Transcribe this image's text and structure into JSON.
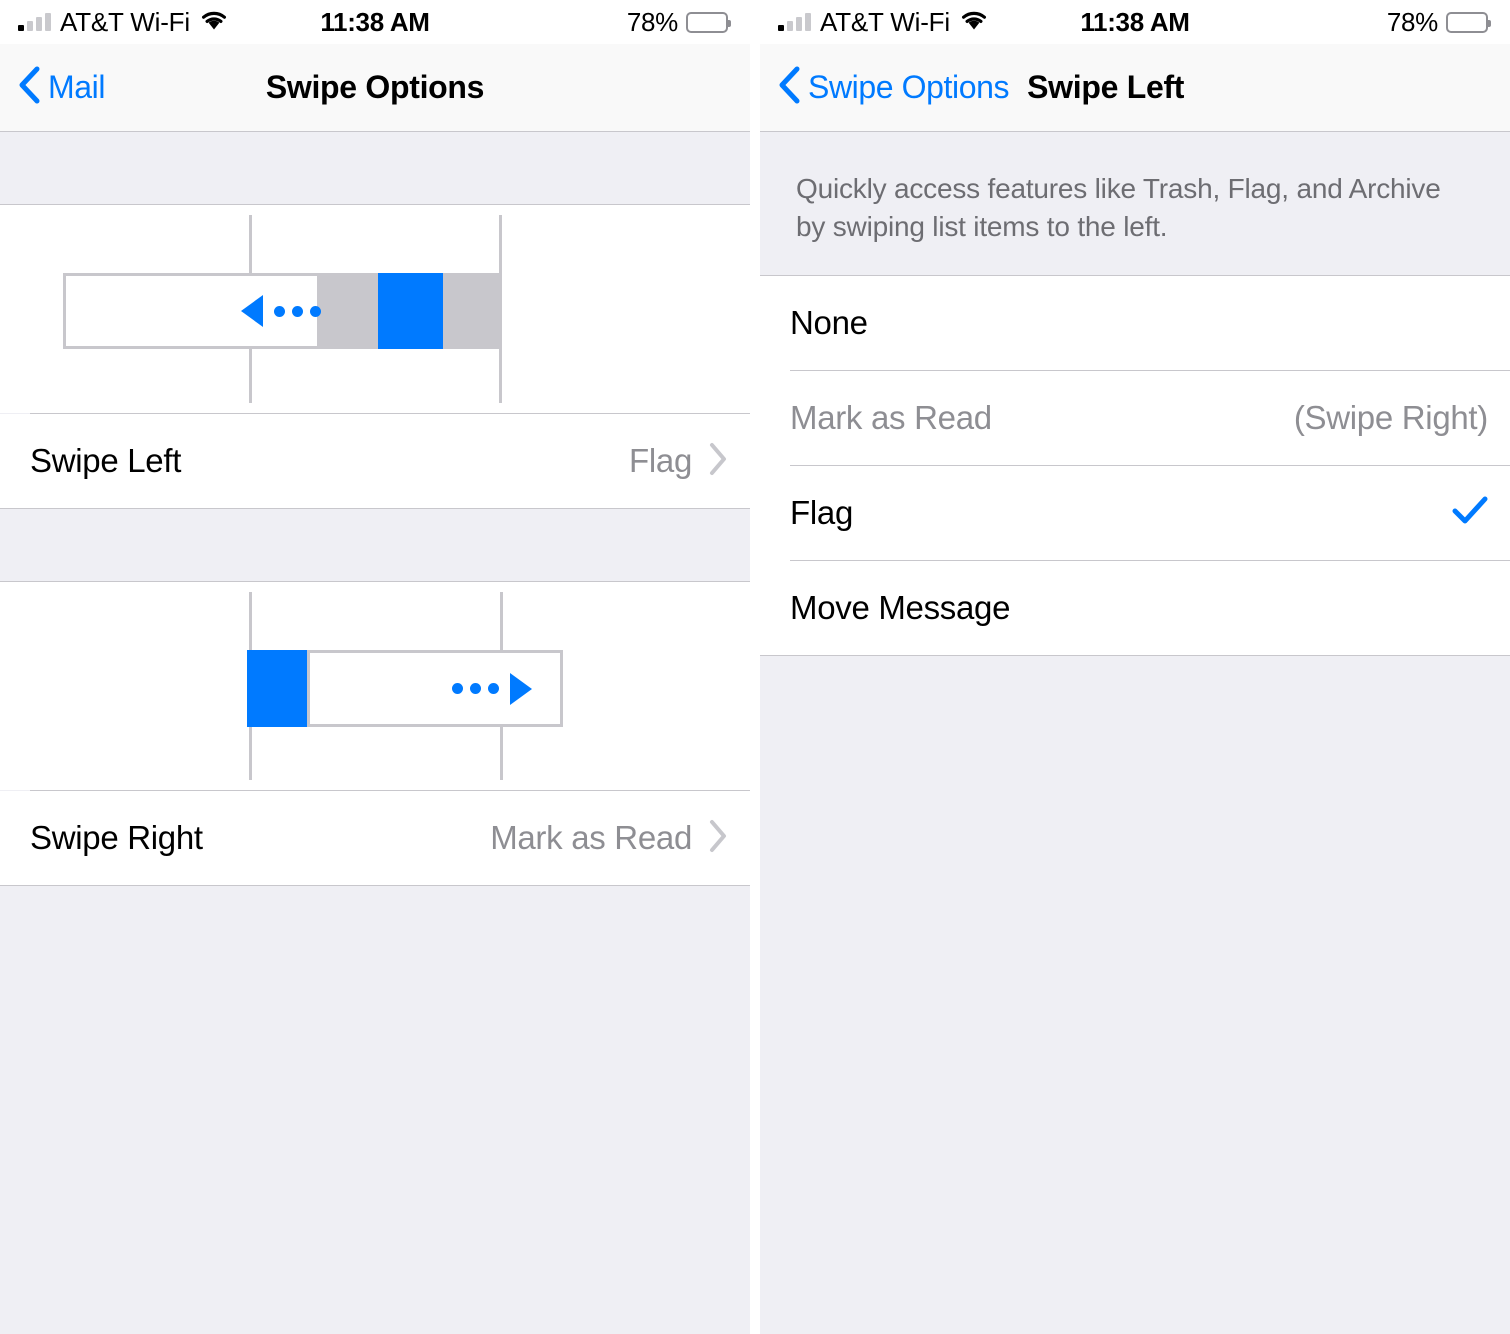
{
  "status_bar": {
    "carrier": "AT&T Wi-Fi",
    "time": "11:38 AM",
    "battery_percent": "78%",
    "signal_icon": "cellular-bars-icon",
    "wifi_icon": "wifi-icon",
    "battery_icon": "battery-icon"
  },
  "colors": {
    "accent_blue": "#007AFF",
    "group_background": "#EFEFF4",
    "row_background": "#FFFFFF",
    "separator": "#C8C7CC",
    "secondary_text": "#8E8E93",
    "description_text": "#6D6D72"
  },
  "left_panel": {
    "nav": {
      "back_label": "Mail",
      "back_icon": "chevron-left-icon",
      "title": "Swipe Options"
    },
    "swipe_left_illustration": {
      "name": "swipe-left-illustration",
      "direction": "left",
      "arrow_icon": "arrow-left-dots-icon",
      "action_color": "#007AFF",
      "neutral_color": "#C8C7CC"
    },
    "swipe_left_row": {
      "label": "Swipe Left",
      "value": "Flag",
      "chevron_icon": "chevron-right-icon"
    },
    "swipe_right_illustration": {
      "name": "swipe-right-illustration",
      "direction": "right",
      "arrow_icon": "arrow-right-dots-icon",
      "action_color": "#007AFF"
    },
    "swipe_right_row": {
      "label": "Swipe Right",
      "value": "Mark as Read",
      "chevron_icon": "chevron-right-icon"
    }
  },
  "right_panel": {
    "nav": {
      "back_label": "Swipe Options",
      "back_icon": "chevron-left-icon",
      "title": "Swipe Left"
    },
    "description": "Quickly access features like Trash, Flag, and Archive by swiping list items to the left.",
    "options": [
      {
        "label": "None",
        "accessory": "",
        "disabled": false,
        "selected": false
      },
      {
        "label": "Mark as Read",
        "accessory": "(Swipe Right)",
        "disabled": true,
        "selected": false
      },
      {
        "label": "Flag",
        "accessory": "",
        "disabled": false,
        "selected": true
      },
      {
        "label": "Move Message",
        "accessory": "",
        "disabled": false,
        "selected": false
      }
    ],
    "checkmark_icon": "checkmark-icon"
  }
}
